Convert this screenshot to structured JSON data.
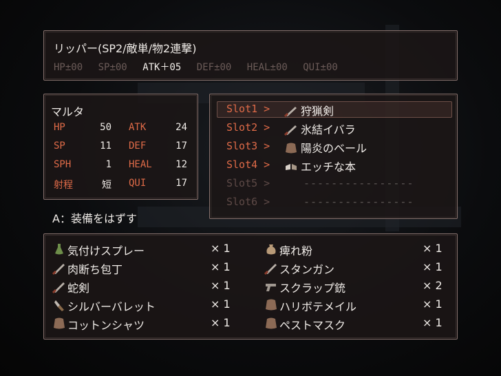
{
  "description": {
    "name": "リッパー(SP2/敵単/物2連撃)",
    "stats": [
      "HP±00",
      "SP±00",
      "ATK＋05",
      "DEF±00",
      "HEAL±00",
      "QUI±00"
    ],
    "highlight_index": 2
  },
  "actor": {
    "name": "マルタ",
    "rows": [
      {
        "l1": "HP",
        "v1": "50",
        "l2": "ATK",
        "v2": "24"
      },
      {
        "l1": "SP",
        "v1": "11",
        "l2": "DEF",
        "v2": "17"
      },
      {
        "l1": "SPH",
        "v1": "1",
        "l2": "HEAL",
        "v2": "12"
      },
      {
        "l1": "射程",
        "v1": "短",
        "l2": "QUI",
        "v2": "17"
      }
    ]
  },
  "slots": [
    {
      "label": "Slot1 >",
      "item": "狩猟剣",
      "icon": "sword-icon"
    },
    {
      "label": "Slot2 >",
      "item": "氷結イバラ",
      "icon": "sword-icon"
    },
    {
      "label": "Slot3 >",
      "item": "陽炎のベール",
      "icon": "cloth-icon"
    },
    {
      "label": "Slot4 >",
      "item": "エッチな本",
      "icon": "book-icon"
    },
    {
      "label": "Slot5 >",
      "item": "",
      "empty": "----------------",
      "icon": ""
    },
    {
      "label": "Slot6 >",
      "item": "",
      "empty": "----------------",
      "icon": ""
    }
  ],
  "selected_slot": 0,
  "hint": "A：装備をはずす",
  "inventory": [
    {
      "name": "気付けスプレー",
      "qty": "× 1",
      "icon": "potion-icon"
    },
    {
      "name": "痺れ粉",
      "qty": "× 1",
      "icon": "pouch-icon"
    },
    {
      "name": "肉断ち包丁",
      "qty": "× 1",
      "icon": "sword-icon"
    },
    {
      "name": "スタンガン",
      "qty": "× 1",
      "icon": "sword-icon"
    },
    {
      "name": "蛇剣",
      "qty": "× 1",
      "icon": "sword-icon"
    },
    {
      "name": "スクラップ銃",
      "qty": "× 2",
      "icon": "gun-icon"
    },
    {
      "name": "シルバーバレット",
      "qty": "× 1",
      "icon": "bullet-icon"
    },
    {
      "name": "ハリボテメイル",
      "qty": "× 1",
      "icon": "cloth-icon"
    },
    {
      "name": "コットンシャツ",
      "qty": "× 1",
      "icon": "cloth-icon"
    },
    {
      "name": "ペストマスク",
      "qty": "× 1",
      "icon": "cloth-icon"
    }
  ],
  "colors": {
    "label": "#e06b48",
    "text": "#f0ece8",
    "dim": "#6b5b58"
  }
}
